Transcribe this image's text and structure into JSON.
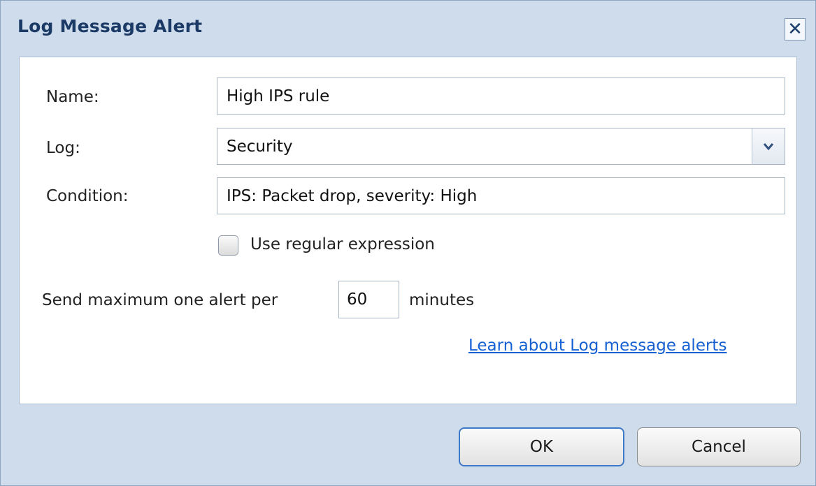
{
  "dialog": {
    "title": "Log Message Alert",
    "close_icon": "close-icon"
  },
  "form": {
    "name_label": "Name:",
    "name_value": "High IPS rule",
    "log_label": "Log:",
    "log_value": "Security",
    "condition_label": "Condition:",
    "condition_value": "IPS: Packet drop, severity: High",
    "regex_label": "Use regular expression",
    "regex_checked": false,
    "send_prefix": "Send maximum one alert per",
    "send_value": "60",
    "send_suffix": "minutes",
    "learn_link": "Learn about Log message alerts"
  },
  "buttons": {
    "ok": "OK",
    "cancel": "Cancel"
  },
  "colors": {
    "dialog_background": "#cfdcec",
    "title_text": "#1b3a66",
    "link": "#1560d3",
    "ok_border": "#3d79c9"
  }
}
